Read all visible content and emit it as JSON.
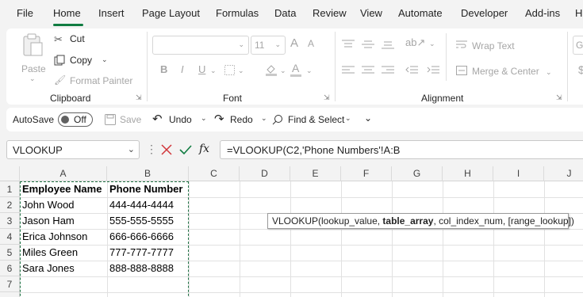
{
  "menu": {
    "tabs": [
      "File",
      "Home",
      "Insert",
      "Page Layout",
      "Formulas",
      "Data",
      "Review",
      "View",
      "Automate",
      "Developer",
      "Add-ins",
      "H"
    ],
    "active": "Home",
    "accent": "#107c41"
  },
  "ribbon": {
    "clipboard": {
      "paste": "Paste",
      "cut": "Cut",
      "copy": "Copy",
      "format_painter": "Format Painter",
      "label": "Clipboard"
    },
    "font": {
      "font_name": "",
      "font_size": "11",
      "grow": "A",
      "shrink": "A",
      "bold": "B",
      "italic": "I",
      "underline": "U",
      "label": "Font"
    },
    "alignment": {
      "wrap_text": "Wrap Text",
      "merge_center": "Merge & Center",
      "label": "Alignment"
    },
    "partial_right": [
      "Ge",
      "$"
    ]
  },
  "qat": {
    "autosave": "AutoSave",
    "toggle": "Off",
    "save": "Save",
    "undo": "Undo",
    "redo": "Redo",
    "find_select": "Find & Select"
  },
  "formula_bar": {
    "name_box": "VLOOKUP",
    "fx": "fx",
    "formula": "=VLOOKUP(C2,'Phone Numbers'!A:B"
  },
  "sheet": {
    "columns": [
      "A",
      "B",
      "C",
      "D",
      "E",
      "F",
      "G",
      "H",
      "I",
      "J"
    ],
    "rows": [
      "1",
      "2",
      "3",
      "4",
      "5",
      "6",
      "7"
    ],
    "headers": [
      "Employee Name",
      "Phone Number"
    ],
    "data": [
      [
        "John Wood",
        "444-444-4444"
      ],
      [
        "Jason Ham",
        "555-555-5555"
      ],
      [
        "Erica Johnson",
        "666-666-6666"
      ],
      [
        "Miles Green",
        "777-777-7777"
      ],
      [
        "Sara Jones",
        "888-888-8888"
      ]
    ]
  },
  "tooltip": {
    "pre": "VLOOKUP(lookup_value, ",
    "bold": "table_array",
    "post": ", col_index_num, [range_lookup])"
  }
}
